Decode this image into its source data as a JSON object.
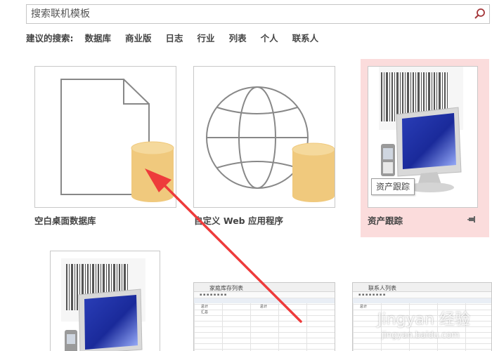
{
  "search": {
    "placeholder": "搜索联机模板"
  },
  "suggestions": {
    "label": "建议的搜索:",
    "items": [
      "数据库",
      "商业版",
      "日志",
      "行业",
      "列表",
      "个人",
      "联系人"
    ]
  },
  "templates": [
    {
      "name": "空白桌面数据库",
      "icon": "blank-database-icon"
    },
    {
      "name": "自定义 Web 应用程序",
      "icon": "web-app-icon"
    },
    {
      "name": "资产跟踪",
      "icon": "asset-tracking-icon",
      "tooltip": "资产跟踪",
      "selected": true
    },
    {
      "name": "",
      "icon": "asset-tracking-icon"
    },
    {
      "name": "",
      "icon": "home-inventory-icon",
      "preview_title": "家庭库存列表"
    },
    {
      "name": "",
      "icon": "contacts-list-icon",
      "preview_title": "联系人列表"
    }
  ],
  "preview_cells": {
    "row1": "总计",
    "row2": "汇总",
    "col": "总计"
  },
  "watermark": {
    "text": "Jingyan 经验",
    "sub": "jingyan.baidu.com"
  },
  "colors": {
    "accent": "#a4373a",
    "selected_bg": "#fbdcdc",
    "cylinder": "#f0c97d",
    "arrow": "#ee3b3b"
  }
}
